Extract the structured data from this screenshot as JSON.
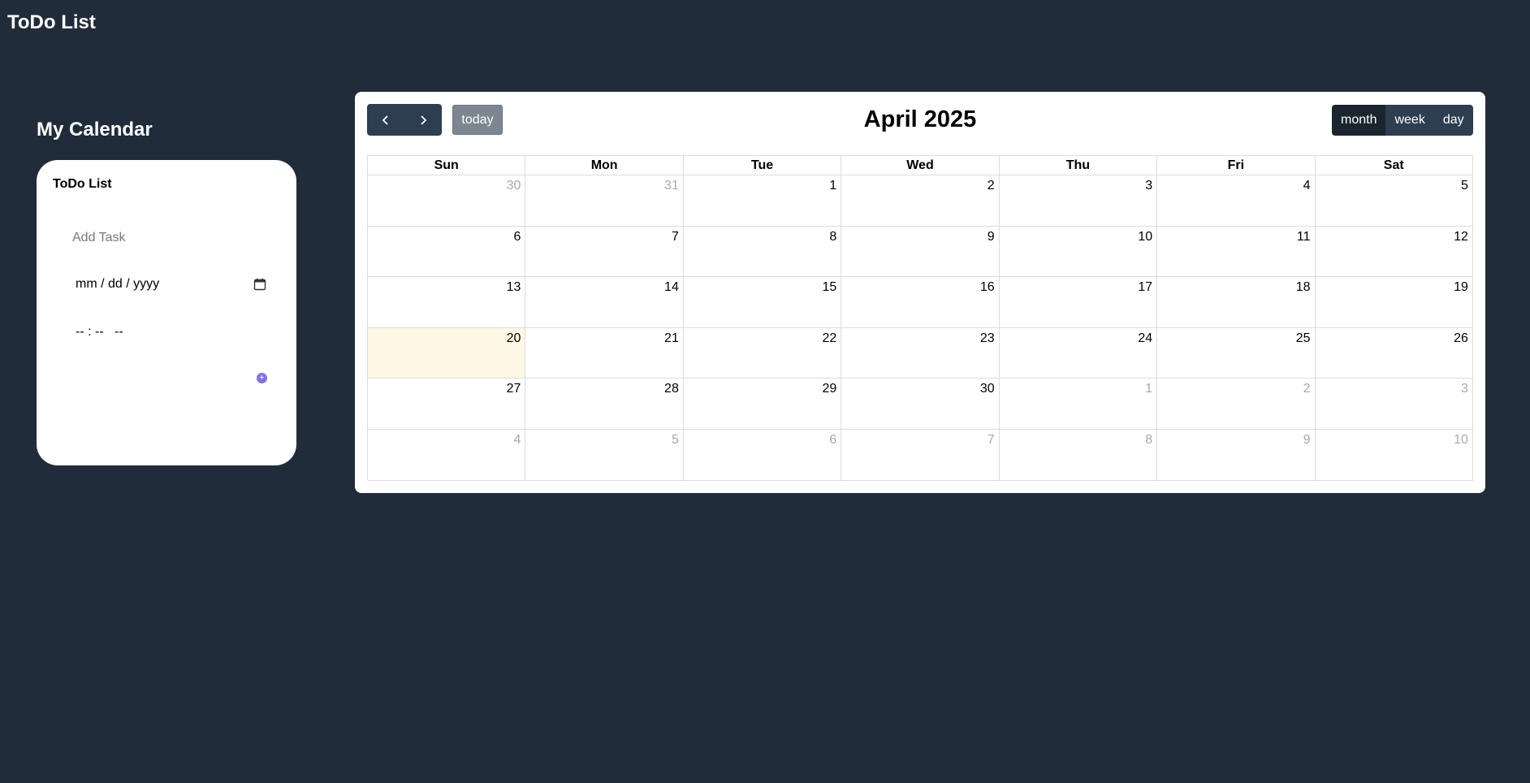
{
  "app": {
    "title": "ToDo List"
  },
  "sidebar": {
    "heading": "My Calendar",
    "card": {
      "title": "ToDo List",
      "task_placeholder": "Add Task",
      "date_placeholder": "mm / dd / yyyy",
      "time_placeholder": "-- : --   --",
      "add_icon": "plus-icon"
    }
  },
  "calendar": {
    "title": "April 2025",
    "today_label": "today",
    "views": [
      "month",
      "week",
      "day"
    ],
    "active_view": "month",
    "weekdays": [
      "Sun",
      "Mon",
      "Tue",
      "Wed",
      "Thu",
      "Fri",
      "Sat"
    ],
    "weeks": [
      [
        {
          "d": "30",
          "o": true
        },
        {
          "d": "31",
          "o": true
        },
        {
          "d": "1"
        },
        {
          "d": "2"
        },
        {
          "d": "3"
        },
        {
          "d": "4"
        },
        {
          "d": "5"
        }
      ],
      [
        {
          "d": "6"
        },
        {
          "d": "7"
        },
        {
          "d": "8"
        },
        {
          "d": "9"
        },
        {
          "d": "10"
        },
        {
          "d": "11"
        },
        {
          "d": "12"
        }
      ],
      [
        {
          "d": "13"
        },
        {
          "d": "14"
        },
        {
          "d": "15"
        },
        {
          "d": "16"
        },
        {
          "d": "17"
        },
        {
          "d": "18"
        },
        {
          "d": "19"
        }
      ],
      [
        {
          "d": "20",
          "today": true
        },
        {
          "d": "21"
        },
        {
          "d": "22"
        },
        {
          "d": "23"
        },
        {
          "d": "24"
        },
        {
          "d": "25"
        },
        {
          "d": "26"
        }
      ],
      [
        {
          "d": "27"
        },
        {
          "d": "28"
        },
        {
          "d": "29"
        },
        {
          "d": "30"
        },
        {
          "d": "1",
          "o": true
        },
        {
          "d": "2",
          "o": true
        },
        {
          "d": "3",
          "o": true
        }
      ],
      [
        {
          "d": "4",
          "o": true
        },
        {
          "d": "5",
          "o": true
        },
        {
          "d": "6",
          "o": true
        },
        {
          "d": "7",
          "o": true
        },
        {
          "d": "8",
          "o": true
        },
        {
          "d": "9",
          "o": true
        },
        {
          "d": "10",
          "o": true
        }
      ]
    ],
    "colors": {
      "background": "#212c3a",
      "button": "#2c3e50",
      "button_active": "#1a252f",
      "today_button": "#7d8791",
      "today_cell": "#fcf8e3",
      "add_button": "#7b73e6"
    }
  }
}
